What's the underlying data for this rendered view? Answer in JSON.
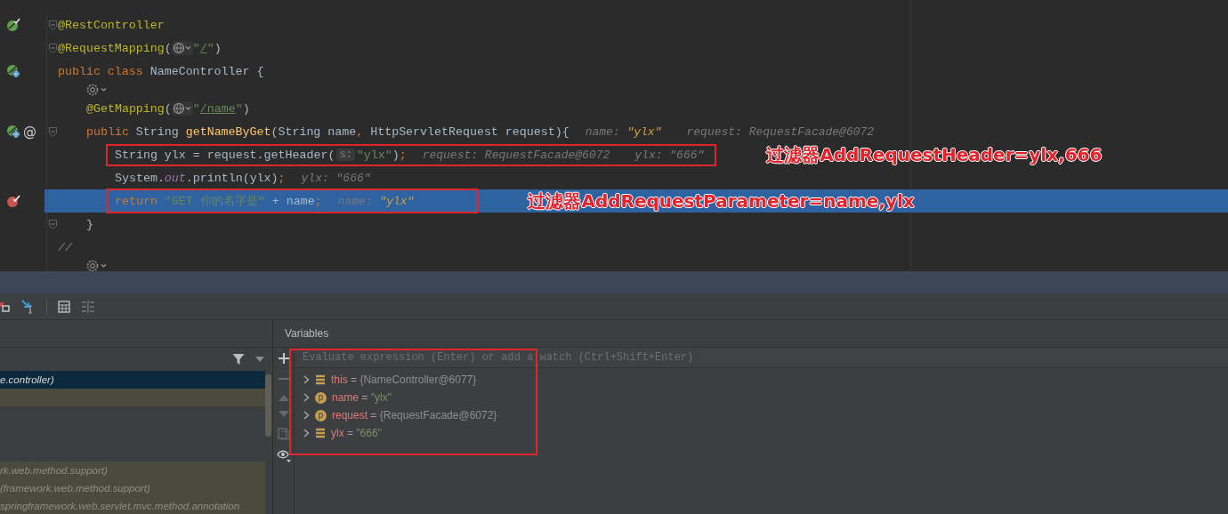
{
  "editor": {
    "lines": [
      {
        "kind": "code",
        "gutter": [
          {
            "kind": "bean-check"
          }
        ],
        "fold": true,
        "highlighted": false,
        "boxed": false,
        "parts": [
          {
            "kind": "code",
            "tokens": [
              {
                "t": "@RestController",
                "kind": "ann"
              }
            ]
          }
        ]
      },
      {
        "kind": "code",
        "fold": true,
        "highlighted": false,
        "boxed": false,
        "parts": [
          {
            "kind": "code",
            "tokens": [
              {
                "t": "@RequestMapping",
                "kind": "ann"
              },
              {
                "t": "(",
                "kind": "plain"
              }
            ]
          },
          {
            "kind": "globe"
          },
          {
            "kind": "code",
            "tokens": [
              {
                "t": "\"",
                "kind": "str"
              },
              {
                "t": "/",
                "kind": "link"
              },
              {
                "t": "\"",
                "kind": "str"
              },
              {
                "t": ")",
                "kind": "plain"
              }
            ]
          }
        ]
      },
      {
        "kind": "code",
        "gutter": [
          {
            "kind": "bean-globe"
          }
        ],
        "fold": false,
        "highlighted": false,
        "boxed": false,
        "parts": [
          {
            "kind": "code",
            "tokens": [
              {
                "t": "public class ",
                "kind": "kw"
              },
              {
                "t": "NameController {",
                "kind": "plain"
              }
            ]
          }
        ],
        "children": [
          {
            "kind": "inlay",
            "fold": false,
            "highlighted": false,
            "boxed": false,
            "parts": [
              {
                "kind": "gear"
              }
            ]
          },
          {
            "kind": "code",
            "fold": false,
            "highlighted": false,
            "boxed": false,
            "parts": [
              {
                "kind": "code",
                "tokens": [
                  {
                    "t": "@GetMapping",
                    "kind": "ann"
                  },
                  {
                    "t": "(",
                    "kind": "plain"
                  }
                ]
              },
              {
                "kind": "globe"
              },
              {
                "kind": "code",
                "tokens": [
                  {
                    "t": "\"",
                    "kind": "str"
                  },
                  {
                    "t": "/name",
                    "kind": "link"
                  },
                  {
                    "t": "\"",
                    "kind": "str"
                  },
                  {
                    "t": ")",
                    "kind": "plain"
                  }
                ]
              }
            ]
          },
          {
            "kind": "code",
            "gutter": [
              {
                "kind": "bean-globe"
              },
              {
                "kind": "text",
                "text": "@"
              }
            ],
            "fold": true,
            "highlighted": false,
            "boxed": false,
            "parts": [
              {
                "kind": "code",
                "tokens": [
                  {
                    "t": "public ",
                    "kind": "kw"
                  },
                  {
                    "t": "String ",
                    "kind": "plain"
                  },
                  {
                    "t": "getNameByGet",
                    "kind": "method"
                  },
                  {
                    "t": "(String name",
                    "kind": "plain"
                  },
                  {
                    "t": ", ",
                    "kind": "kw"
                  },
                  {
                    "t": "HttpServletRequest request){",
                    "kind": "plain"
                  }
                ]
              },
              {
                "kind": "hint",
                "tokens": [
                  {
                    "t": "name: ",
                    "kind": "hint"
                  },
                  {
                    "t": "\"ylx\"",
                    "kind": "hintval"
                  }
                ]
              },
              {
                "kind": "hint",
                "tokens": [
                  {
                    "t": "request: RequestFacade@6072",
                    "kind": "hint"
                  }
                ]
              }
            ],
            "children": [
              {
                "kind": "code",
                "fold": false,
                "highlighted": false,
                "boxed": true,
                "callout": "过滤器AddRequestHeader=ylx,666",
                "parts": [
                  {
                    "kind": "code",
                    "tokens": [
                      {
                        "t": "String ylx = request.getHeader(",
                        "kind": "plain"
                      }
                    ]
                  },
                  {
                    "kind": "param",
                    "text": "s:"
                  },
                  {
                    "kind": "code",
                    "tokens": [
                      {
                        "t": "\"ylx\"",
                        "kind": "str"
                      },
                      {
                        "t": ")",
                        "kind": "plain"
                      },
                      {
                        "t": ";",
                        "kind": "kw"
                      }
                    ]
                  },
                  {
                    "kind": "hint",
                    "tokens": [
                      {
                        "t": "request: RequestFacade@6072",
                        "kind": "hint"
                      }
                    ]
                  },
                  {
                    "kind": "hint",
                    "tokens": [
                      {
                        "t": "ylx: \"666\"",
                        "kind": "hint"
                      }
                    ]
                  }
                ]
              },
              {
                "kind": "code",
                "fold": false,
                "highlighted": false,
                "boxed": false,
                "parts": [
                  {
                    "kind": "code",
                    "tokens": [
                      {
                        "t": "System.",
                        "kind": "plain"
                      },
                      {
                        "t": "out",
                        "kind": "static"
                      },
                      {
                        "t": ".println(ylx)",
                        "kind": "plain"
                      },
                      {
                        "t": ";",
                        "kind": "kw"
                      }
                    ]
                  },
                  {
                    "kind": "hint",
                    "tokens": [
                      {
                        "t": "ylx: \"666\"",
                        "kind": "hint"
                      }
                    ]
                  }
                ]
              },
              {
                "kind": "code",
                "gutter": [
                  {
                    "kind": "breakpoint"
                  }
                ],
                "fold": false,
                "highlighted": true,
                "boxed": true,
                "callout": "过滤器AddRequestParameter=name,ylx",
                "parts": [
                  {
                    "kind": "code",
                    "tokens": [
                      {
                        "t": "return ",
                        "kind": "kw"
                      },
                      {
                        "t": "\"GET 你的名字是\"",
                        "kind": "str"
                      },
                      {
                        "t": " + name",
                        "kind": "plain"
                      },
                      {
                        "t": ";",
                        "kind": "kw"
                      }
                    ]
                  },
                  {
                    "kind": "hint",
                    "tokens": [
                      {
                        "t": "name: ",
                        "kind": "hint"
                      },
                      {
                        "t": "\"ylx\"",
                        "kind": "hintval"
                      }
                    ]
                  }
                ]
              }
            ]
          },
          {
            "kind": "code",
            "fold": true,
            "highlighted": false,
            "boxed": false,
            "parts": [
              {
                "kind": "code",
                "tokens": [
                  {
                    "t": "}",
                    "kind": "plain"
                  }
                ]
              }
            ]
          }
        ]
      },
      {
        "kind": "code",
        "fold": false,
        "highlighted": false,
        "boxed": false,
        "parts": [
          {
            "kind": "code",
            "tokens": [
              {
                "t": "//",
                "kind": "comment"
              }
            ]
          }
        ],
        "children": [
          {
            "kind": "inlay",
            "fold": false,
            "highlighted": false,
            "boxed": false,
            "parts": [
              {
                "kind": "gear"
              }
            ]
          }
        ]
      }
    ]
  },
  "toolbar": [
    {
      "kind": "stop-frame"
    },
    {
      "kind": "cursor"
    },
    {
      "kind": "sep"
    },
    {
      "kind": "table"
    },
    {
      "kind": "list",
      "disabled": true
    }
  ],
  "frames": {
    "items": [
      {
        "text": "e.controller)",
        "selected": true,
        "library": false
      },
      {
        "text": "rk.web.method.support)",
        "selected": false,
        "library": true
      },
      {
        "text": "(framework.web.method.support)",
        "selected": false,
        "library": true
      },
      {
        "text": "springframework.web.servlet.mvc.method.annotation",
        "selected": false,
        "library": true
      }
    ]
  },
  "variables": {
    "title": "Variables",
    "placeholder": "Evaluate expression (Enter) or add a watch (Ctrl+Shift+Enter)",
    "highlight_frame": true,
    "items": [
      {
        "icon": {
          "kind": "field"
        },
        "name": "this",
        "op": "=",
        "value": "{NameController@6077}",
        "kind": "obj"
      },
      {
        "icon": {
          "kind": "param",
          "letter": "p"
        },
        "name": "name",
        "op": "=",
        "value": "\"ylx\"",
        "kind": "str"
      },
      {
        "icon": {
          "kind": "param",
          "letter": "p"
        },
        "name": "request",
        "op": "=",
        "value": "{RequestFacade@6072}",
        "kind": "obj"
      },
      {
        "icon": {
          "kind": "field"
        },
        "name": "ylx",
        "op": "=",
        "value": "\"666\"",
        "kind": "str"
      }
    ]
  }
}
